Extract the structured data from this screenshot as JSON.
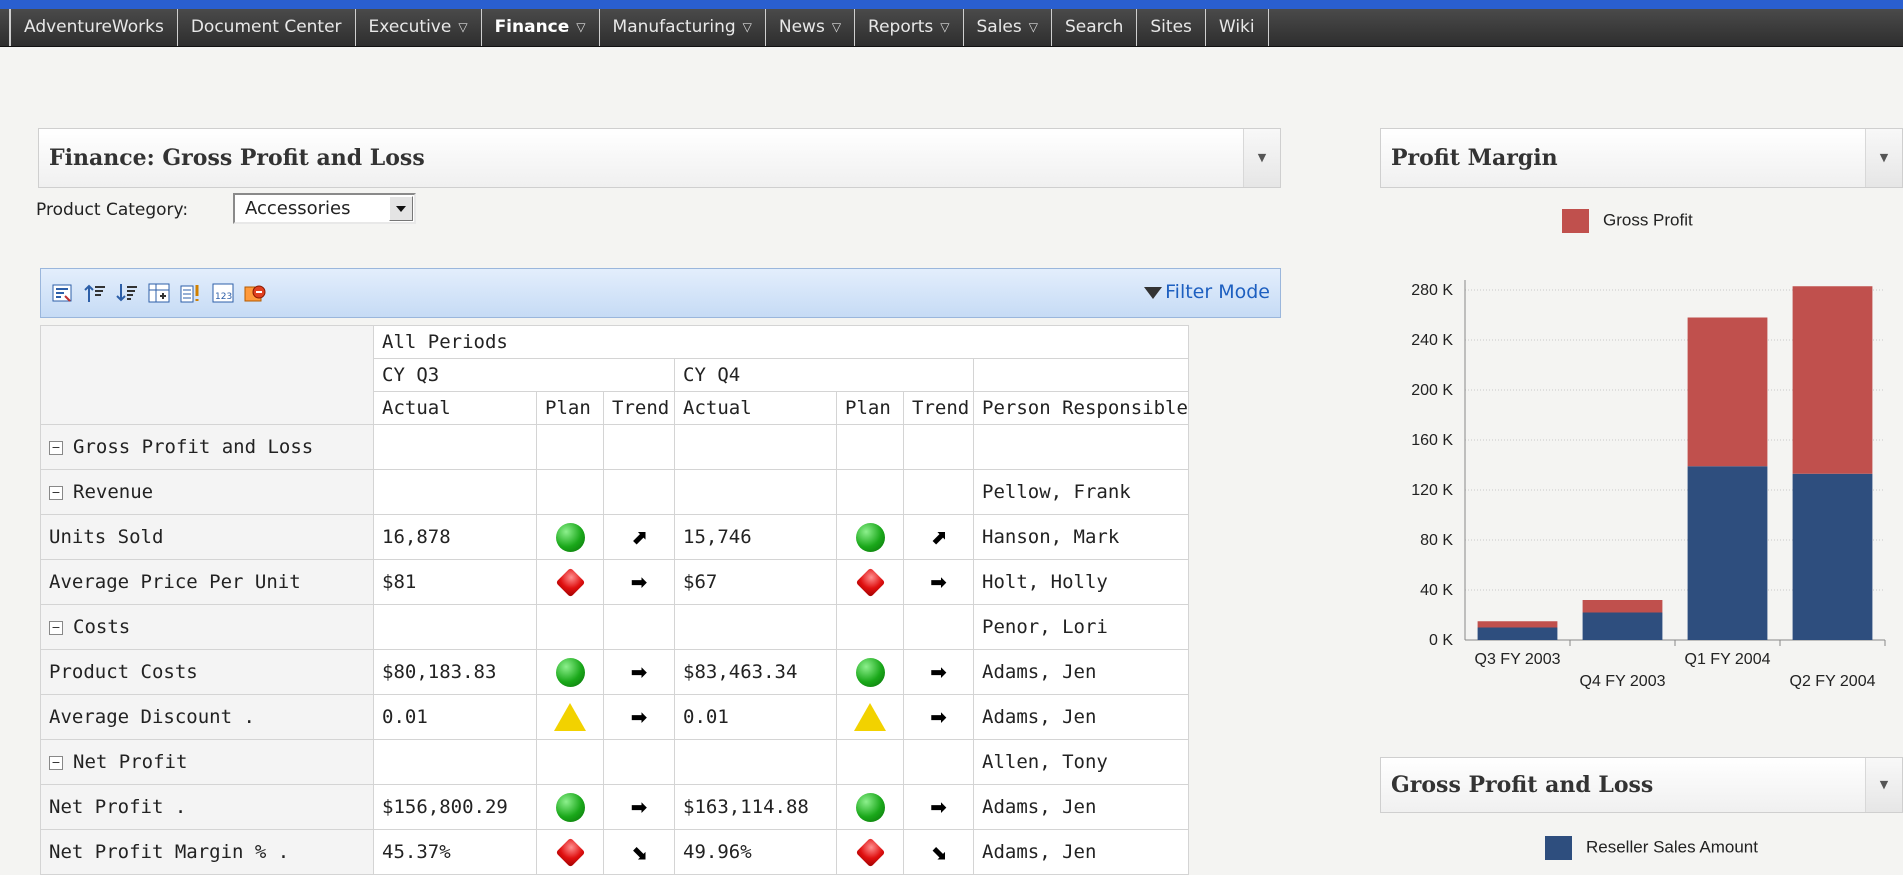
{
  "nav": {
    "items": [
      {
        "label": "AdventureWorks",
        "dropdown": false,
        "bold": false
      },
      {
        "label": "Document Center",
        "dropdown": false,
        "bold": false
      },
      {
        "label": "Executive",
        "dropdown": true,
        "bold": false
      },
      {
        "label": "Finance",
        "dropdown": true,
        "bold": true
      },
      {
        "label": "Manufacturing",
        "dropdown": true,
        "bold": false
      },
      {
        "label": "News",
        "dropdown": true,
        "bold": false
      },
      {
        "label": "Reports",
        "dropdown": true,
        "bold": false
      },
      {
        "label": "Sales",
        "dropdown": true,
        "bold": false
      },
      {
        "label": "Search",
        "dropdown": false,
        "bold": false
      },
      {
        "label": "Sites",
        "dropdown": false,
        "bold": false
      },
      {
        "label": "Wiki",
        "dropdown": false,
        "bold": false
      }
    ],
    "dropdown_glyph": "▽"
  },
  "finance_panel": {
    "title": "Finance: Gross Profit and Loss",
    "filter_label": "Product Category:",
    "filter_value": "Accessories",
    "filter_mode_label": "Filter Mode"
  },
  "grid": {
    "header": {
      "all_periods": "All Periods",
      "q3": "CY Q3",
      "q4": "CY Q4",
      "actual": "Actual",
      "plan": "Plan",
      "trend": "Trend",
      "person": "Person Responsible"
    },
    "rows": [
      {
        "label": "Gross Profit and Loss",
        "level": 0,
        "expandable": true,
        "q3_actual": "",
        "q3_plan": "",
        "q3_trend": "",
        "q4_actual": "",
        "q4_plan": "",
        "q4_trend": "",
        "person": ""
      },
      {
        "label": "Revenue",
        "level": 1,
        "expandable": true,
        "q3_actual": "",
        "q3_plan": "",
        "q3_trend": "",
        "q4_actual": "",
        "q4_plan": "",
        "q4_trend": "",
        "person": "Pellow, Frank"
      },
      {
        "label": "Units Sold",
        "level": 2,
        "expandable": false,
        "q3_actual": "16,878",
        "q3_plan": "green",
        "q3_trend": "up-right",
        "q4_actual": "15,746",
        "q4_plan": "green",
        "q4_trend": "up-right",
        "person": "Hanson, Mark"
      },
      {
        "label": "Average Price Per Unit",
        "level": 2,
        "expandable": false,
        "q3_actual": "$81",
        "q3_plan": "red",
        "q3_trend": "right",
        "q4_actual": "$67",
        "q4_plan": "red",
        "q4_trend": "right",
        "person": "Holt, Holly"
      },
      {
        "label": "Costs",
        "level": 1,
        "expandable": true,
        "q3_actual": "",
        "q3_plan": "",
        "q3_trend": "",
        "q4_actual": "",
        "q4_plan": "",
        "q4_trend": "",
        "person": "Penor, Lori"
      },
      {
        "label": "Product Costs",
        "level": 2,
        "expandable": false,
        "q3_actual": "$80,183.83",
        "q3_plan": "green",
        "q3_trend": "right",
        "q4_actual": "$83,463.34",
        "q4_plan": "green",
        "q4_trend": "right",
        "person": "Adams, Jen"
      },
      {
        "label": "Average Discount .",
        "level": 2,
        "expandable": false,
        "q3_actual": "0.01",
        "q3_plan": "yellow",
        "q3_trend": "right",
        "q4_actual": "0.01",
        "q4_plan": "yellow",
        "q4_trend": "right",
        "person": "Adams, Jen"
      },
      {
        "label": "Net Profit",
        "level": 1,
        "expandable": true,
        "q3_actual": "",
        "q3_plan": "",
        "q3_trend": "",
        "q4_actual": "",
        "q4_plan": "",
        "q4_trend": "",
        "person": "Allen, Tony"
      },
      {
        "label": "Net Profit .",
        "level": 2,
        "expandable": false,
        "q3_actual": "$156,800.29",
        "q3_plan": "green",
        "q3_trend": "right",
        "q4_actual": "$163,114.88",
        "q4_plan": "green",
        "q4_trend": "right",
        "person": "Adams, Jen"
      },
      {
        "label": "Net Profit Margin % .",
        "level": 2,
        "expandable": false,
        "q3_actual": "45.37%",
        "q3_plan": "red",
        "q3_trend": "down-right",
        "q4_actual": "49.96%",
        "q4_plan": "red",
        "q4_trend": "down-right",
        "person": "Adams, Jen"
      }
    ]
  },
  "profit_margin_panel": {
    "title": "Profit Margin"
  },
  "gross_panel": {
    "title": "Gross Profit and Loss",
    "legend_label": "Reseller Sales Amount"
  },
  "colors": {
    "gross_profit": "#c0504d",
    "reseller_sales": "#2e4e7e"
  },
  "chart_data": {
    "type": "bar",
    "stacked": true,
    "categories": [
      "Q3 FY 2003",
      "Q4 FY 2003",
      "Q1 FY 2004",
      "Q2 FY 2004"
    ],
    "series": [
      {
        "name": "Reseller Sales Amount",
        "values": [
          10000,
          22000,
          139000,
          133000
        ]
      },
      {
        "name": "Gross Profit",
        "values": [
          5000,
          10000,
          119000,
          150000
        ]
      }
    ],
    "legend_visible": [
      "Gross Profit"
    ],
    "yticks": [
      "0 K",
      "40 K",
      "80 K",
      "120 K",
      "160 K",
      "200 K",
      "240 K",
      "280 K"
    ],
    "ylim": [
      0,
      280000
    ],
    "grid": true,
    "legend_position": "top"
  }
}
